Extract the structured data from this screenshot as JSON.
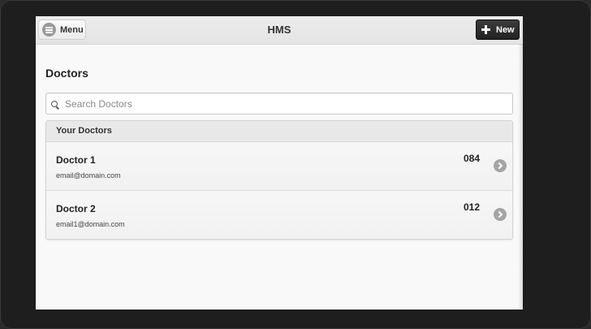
{
  "header": {
    "title": "HMS",
    "menu_label": "Menu",
    "new_label": "New"
  },
  "page": {
    "heading": "Doctors"
  },
  "search": {
    "placeholder": "Search Doctors",
    "value": ""
  },
  "list": {
    "divider": "Your Doctors",
    "items": [
      {
        "name": "Doctor 1",
        "email": "email@domain.com",
        "count": "084"
      },
      {
        "name": "Doctor 2",
        "email": "email1@domain.com",
        "count": "012"
      }
    ]
  },
  "icons": {
    "menu": "menu-icon",
    "new": "plus-icon",
    "search": "search-icon",
    "chevron": "chevron-right-icon"
  },
  "colors": {
    "header_bg": "#e6e6e6",
    "new_button_bg": "#2b2b2b",
    "page_bg": "#f9f9f9",
    "device_frame": "#1e1e1e"
  }
}
